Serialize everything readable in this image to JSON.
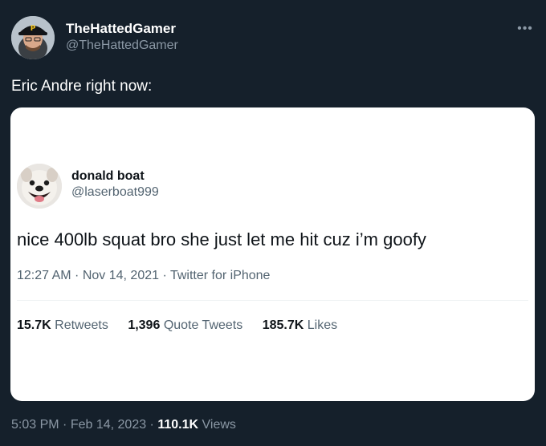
{
  "author": {
    "display_name": "TheHattedGamer",
    "handle": "@TheHattedGamer",
    "avatar": "profile-avatar"
  },
  "more_icon": "more-options-icon",
  "tweet": {
    "text": "Eric Andre right now:",
    "time": "5:03 PM",
    "date": "Feb 14, 2023",
    "views_count": "110.1K",
    "views_label": "Views",
    "separator": " · "
  },
  "quoted": {
    "display_name": "donald boat",
    "handle": "@laserboat999",
    "avatar": "profile-avatar-dog",
    "text": "nice 400lb squat bro she just let me hit cuz i’m goofy",
    "time": "12:27 AM",
    "date": "Nov 14, 2021",
    "source": "Twitter for iPhone",
    "stats": {
      "retweets_count": "15.7K",
      "retweets_label": "Retweets",
      "quotes_count": "1,396",
      "quotes_label": "Quote Tweets",
      "likes_count": "185.7K",
      "likes_label": "Likes"
    }
  },
  "colors": {
    "background": "#15202b",
    "card": "#ffffff",
    "secondary_text_dark": "#8b98a5",
    "secondary_text_light": "#536471"
  }
}
